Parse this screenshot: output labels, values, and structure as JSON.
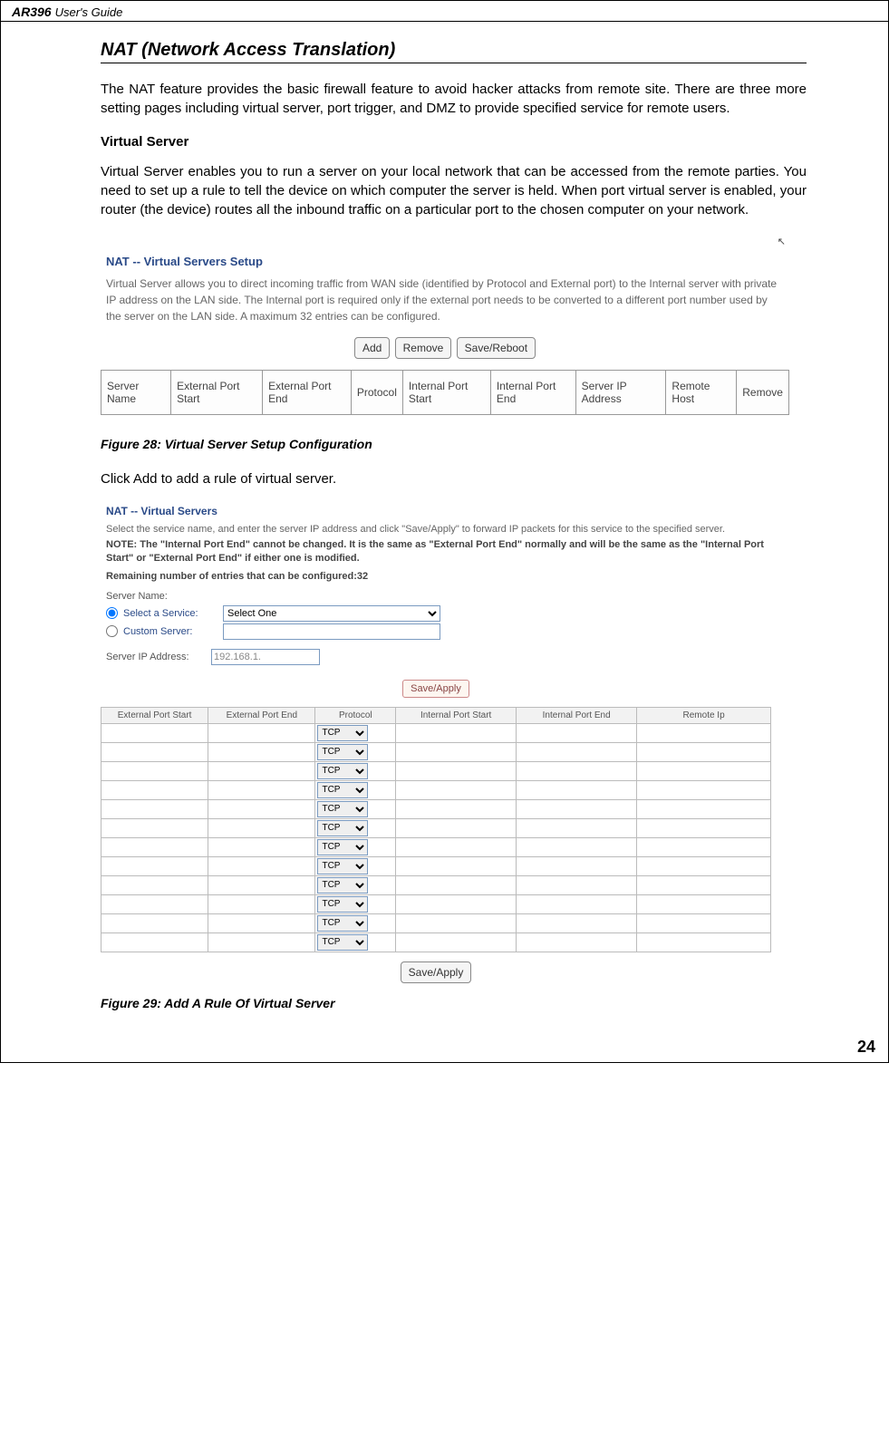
{
  "header": {
    "model": "AR396",
    "guide_suffix": " User's Guide"
  },
  "section_title": "NAT (Network Access Translation)",
  "intro": "The NAT feature provides the basic firewall feature to avoid hacker attacks from remote site. There are three more setting pages including virtual server, port trigger, and DMZ to provide specified service for remote users.",
  "vs_subtitle": "Virtual Server",
  "vs_para": "Virtual Server enables you to run a server on your local network that can be accessed from the remote parties. You need to set up a rule to tell the device on which computer the server is held. When port virtual server is enabled, your router (the device) routes all the inbound traffic on a particular port to the chosen computer on your network.",
  "shot1": {
    "title": "NAT -- Virtual Servers Setup",
    "desc": "Virtual Server allows you to direct incoming traffic from WAN side (identified by Protocol and External port) to the Internal server with private IP address on the LAN side. The Internal port is required only if the external port needs to be converted to a different port number used by the server on the LAN side. A maximum 32 entries can be configured.",
    "buttons": {
      "add": "Add",
      "remove": "Remove",
      "save": "Save/Reboot"
    },
    "headers": [
      "Server Name",
      "External Port Start",
      "External Port End",
      "Protocol",
      "Internal Port Start",
      "Internal Port End",
      "Server IP Address",
      "Remote Host",
      "Remove"
    ]
  },
  "fig28": "Figure 28: Virtual Server Setup Configuration",
  "click_add": "Click Add to add a rule of virtual server.",
  "shot2": {
    "title": "NAT -- Virtual Servers",
    "desc": "Select the service name, and enter the server IP address and click \"Save/Apply\" to forward IP packets for this service to the specified server.",
    "note": "NOTE: The \"Internal Port End\" cannot be changed. It is the same as \"External Port End\" normally and will be the same as the \"Internal Port Start\" or \"External Port End\" if either one is modified.",
    "remain": "Remaining number of entries that can be configured:32",
    "server_name_label": "Server Name:",
    "select_service": "Select a Service:",
    "select_one": "Select One",
    "custom_server": "Custom Server:",
    "server_ip_label": "Server IP Address:",
    "server_ip_value": "192.168.1.",
    "save_apply": "Save/Apply",
    "port_headers": [
      "External Port Start",
      "External Port End",
      "Protocol",
      "Internal Port Start",
      "Internal Port End",
      "Remote Ip"
    ],
    "proto": "TCP",
    "row_count": 12
  },
  "fig29": "Figure 29: Add A Rule Of Virtual Server",
  "pagenum": "24"
}
